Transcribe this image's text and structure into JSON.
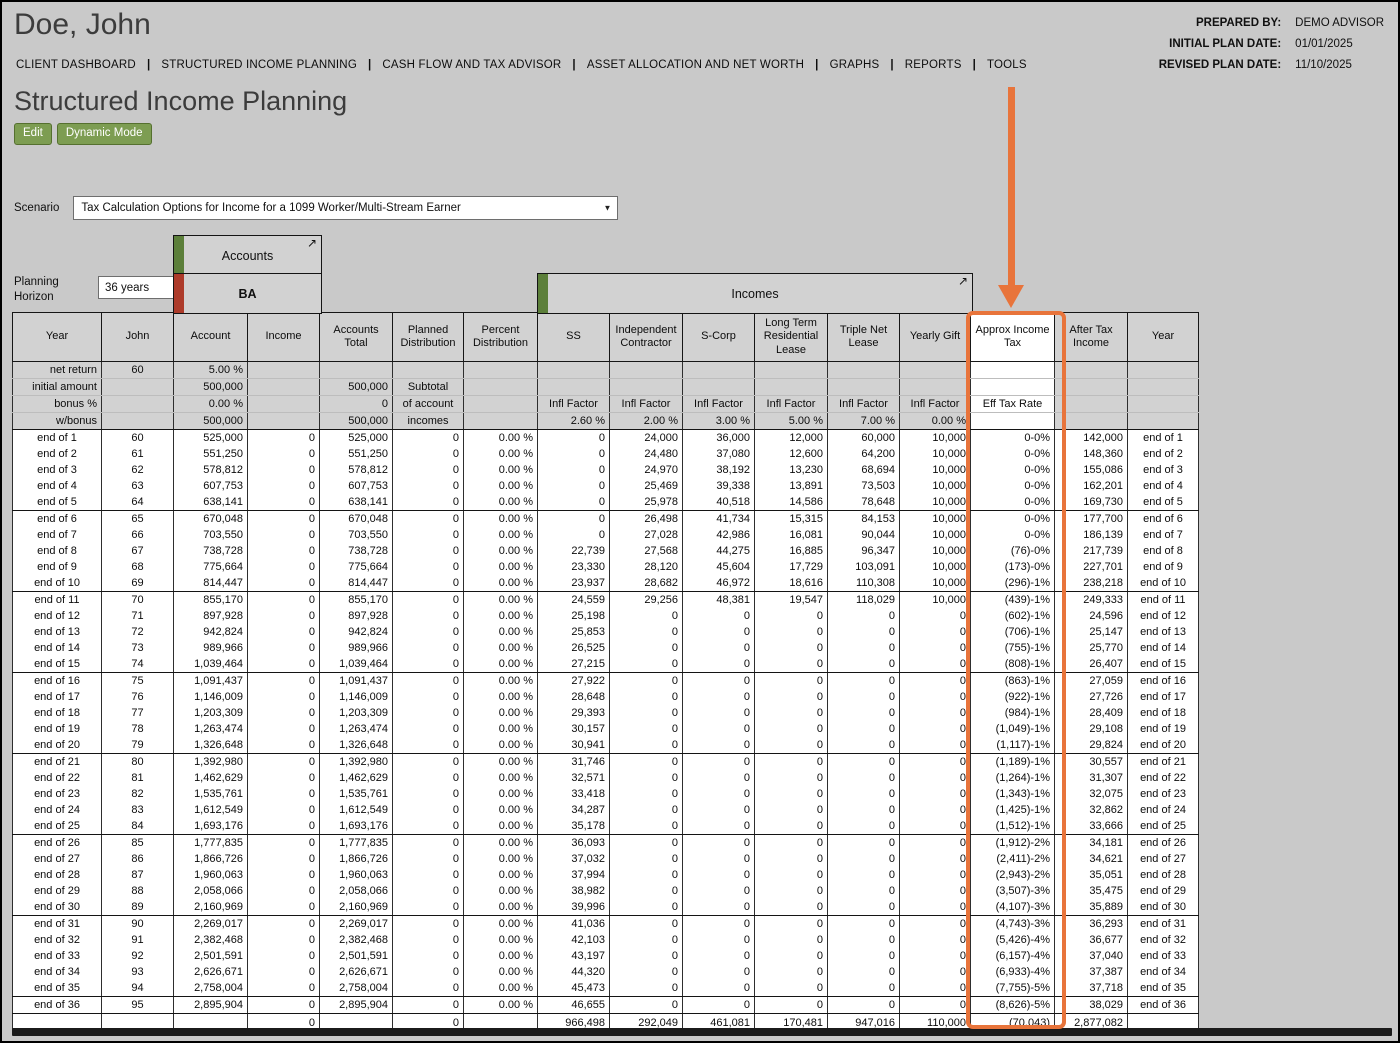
{
  "header": {
    "client_name": "Doe, John",
    "prepared_by_label": "PREPARED BY:",
    "prepared_by_value": "DEMO ADVISOR",
    "initial_plan_date_label": "INITIAL PLAN DATE:",
    "initial_plan_date_value": "01/01/2025",
    "revised_plan_date_label": "REVISED PLAN DATE:",
    "revised_plan_date_value": "11/10/2025"
  },
  "nav": {
    "separator": "|",
    "items": [
      "CLIENT DASHBOARD",
      "STRUCTURED INCOME PLANNING",
      "CASH FLOW AND TAX ADVISOR",
      "ASSET ALLOCATION AND NET WORTH",
      "GRAPHS",
      "REPORTS",
      "TOOLS"
    ]
  },
  "page": {
    "title": "Structured Income Planning"
  },
  "toolbar": {
    "edit_label": "Edit",
    "dynamic_mode_label": "Dynamic Mode"
  },
  "scenario": {
    "label": "Scenario",
    "value": "Tax Calculation Options for Income for a 1099 Worker/Multi-Stream Earner"
  },
  "planning_horizon": {
    "label_line1": "Planning",
    "label_line2": "Horizon",
    "value": "36 years"
  },
  "groups": {
    "accounts": "Accounts",
    "ba": "BA",
    "incomes": "Incomes",
    "expand_icon_glyph": "↗",
    "chevron_glyph": "▼"
  },
  "table": {
    "columns": [
      "Year",
      "John",
      "Account",
      "Income",
      "Accounts Total",
      "Planned Distribution",
      "Percent Distribution",
      "SS",
      "Independent Contractor",
      "S-Corp",
      "Long Term Residential Lease",
      "Triple Net Lease",
      "Yearly Gift",
      "Approx Income Tax",
      "After Tax Income",
      "Year"
    ],
    "setup_rows": [
      {
        "name": "net-return",
        "cells": [
          "net return",
          "60",
          "5.00 %",
          "",
          "",
          "",
          "",
          "",
          "",
          "",
          "",
          "",
          "",
          "",
          "",
          ""
        ],
        "orange": [
          2
        ],
        "center": [
          1
        ]
      },
      {
        "name": "initial-amount",
        "cells": [
          "initial amount",
          "",
          "500,000",
          "",
          "500,000",
          "Subtotal",
          "",
          "",
          "",
          "",
          "",
          "",
          "",
          "",
          "",
          ""
        ],
        "orange": [],
        "center": [
          5
        ]
      },
      {
        "name": "bonus-pct",
        "cells": [
          "bonus %",
          "",
          "0.00 %",
          "",
          "0",
          "of account",
          "",
          "Infl Factor",
          "Infl Factor",
          "Infl Factor",
          "Infl Factor",
          "Infl Factor",
          "Infl Factor",
          "Eff Tax Rate",
          "",
          ""
        ],
        "orange": [],
        "center": [
          5,
          7,
          8,
          9,
          10,
          11,
          12,
          13
        ]
      },
      {
        "name": "w-bonus",
        "cells": [
          "w/bonus",
          "",
          "500,000",
          "",
          "500,000",
          "incomes",
          "",
          "2.60 %",
          "2.00 %",
          "3.00 %",
          "5.00 %",
          "7.00 %",
          "0.00 %",
          "",
          "",
          ""
        ],
        "orange": [
          7,
          8,
          9,
          10,
          11,
          12
        ],
        "center": [
          5
        ]
      }
    ],
    "rows": [
      [
        "end of 1",
        "60",
        "525,000",
        "0",
        "525,000",
        "0",
        "0.00 %",
        "0",
        "24,000",
        "36,000",
        "12,000",
        "60,000",
        "10,000",
        "0-0%",
        "142,000"
      ],
      [
        "end of 2",
        "61",
        "551,250",
        "0",
        "551,250",
        "0",
        "0.00 %",
        "0",
        "24,480",
        "37,080",
        "12,600",
        "64,200",
        "10,000",
        "0-0%",
        "148,360"
      ],
      [
        "end of 3",
        "62",
        "578,812",
        "0",
        "578,812",
        "0",
        "0.00 %",
        "0",
        "24,970",
        "38,192",
        "13,230",
        "68,694",
        "10,000",
        "0-0%",
        "155,086"
      ],
      [
        "end of 4",
        "63",
        "607,753",
        "0",
        "607,753",
        "0",
        "0.00 %",
        "0",
        "25,469",
        "39,338",
        "13,891",
        "73,503",
        "10,000",
        "0-0%",
        "162,201"
      ],
      [
        "end of 5",
        "64",
        "638,141",
        "0",
        "638,141",
        "0",
        "0.00 %",
        "0",
        "25,978",
        "40,518",
        "14,586",
        "78,648",
        "10,000",
        "0-0%",
        "169,730"
      ],
      [
        "end of 6",
        "65",
        "670,048",
        "0",
        "670,048",
        "0",
        "0.00 %",
        "0",
        "26,498",
        "41,734",
        "15,315",
        "84,153",
        "10,000",
        "0-0%",
        "177,700"
      ],
      [
        "end of 7",
        "66",
        "703,550",
        "0",
        "703,550",
        "0",
        "0.00 %",
        "0",
        "27,028",
        "42,986",
        "16,081",
        "90,044",
        "10,000",
        "0-0%",
        "186,139"
      ],
      [
        "end of 8",
        "67",
        "738,728",
        "0",
        "738,728",
        "0",
        "0.00 %",
        "22,739",
        "27,568",
        "44,275",
        "16,885",
        "96,347",
        "10,000",
        "(76)-0%",
        "217,739"
      ],
      [
        "end of 9",
        "68",
        "775,664",
        "0",
        "775,664",
        "0",
        "0.00 %",
        "23,330",
        "28,120",
        "45,604",
        "17,729",
        "103,091",
        "10,000",
        "(173)-0%",
        "227,701"
      ],
      [
        "end of 10",
        "69",
        "814,447",
        "0",
        "814,447",
        "0",
        "0.00 %",
        "23,937",
        "28,682",
        "46,972",
        "18,616",
        "110,308",
        "10,000",
        "(296)-1%",
        "238,218"
      ],
      [
        "end of 11",
        "70",
        "855,170",
        "0",
        "855,170",
        "0",
        "0.00 %",
        "24,559",
        "29,256",
        "48,381",
        "19,547",
        "118,029",
        "10,000",
        "(439)-1%",
        "249,333"
      ],
      [
        "end of 12",
        "71",
        "897,928",
        "0",
        "897,928",
        "0",
        "0.00 %",
        "25,198",
        "0",
        "0",
        "0",
        "0",
        "0",
        "(602)-1%",
        "24,596"
      ],
      [
        "end of 13",
        "72",
        "942,824",
        "0",
        "942,824",
        "0",
        "0.00 %",
        "25,853",
        "0",
        "0",
        "0",
        "0",
        "0",
        "(706)-1%",
        "25,147"
      ],
      [
        "end of 14",
        "73",
        "989,966",
        "0",
        "989,966",
        "0",
        "0.00 %",
        "26,525",
        "0",
        "0",
        "0",
        "0",
        "0",
        "(755)-1%",
        "25,770"
      ],
      [
        "end of 15",
        "74",
        "1,039,464",
        "0",
        "1,039,464",
        "0",
        "0.00 %",
        "27,215",
        "0",
        "0",
        "0",
        "0",
        "0",
        "(808)-1%",
        "26,407"
      ],
      [
        "end of 16",
        "75",
        "1,091,437",
        "0",
        "1,091,437",
        "0",
        "0.00 %",
        "27,922",
        "0",
        "0",
        "0",
        "0",
        "0",
        "(863)-1%",
        "27,059"
      ],
      [
        "end of 17",
        "76",
        "1,146,009",
        "0",
        "1,146,009",
        "0",
        "0.00 %",
        "28,648",
        "0",
        "0",
        "0",
        "0",
        "0",
        "(922)-1%",
        "27,726"
      ],
      [
        "end of 18",
        "77",
        "1,203,309",
        "0",
        "1,203,309",
        "0",
        "0.00 %",
        "29,393",
        "0",
        "0",
        "0",
        "0",
        "0",
        "(984)-1%",
        "28,409"
      ],
      [
        "end of 19",
        "78",
        "1,263,474",
        "0",
        "1,263,474",
        "0",
        "0.00 %",
        "30,157",
        "0",
        "0",
        "0",
        "0",
        "0",
        "(1,049)-1%",
        "29,108"
      ],
      [
        "end of 20",
        "79",
        "1,326,648",
        "0",
        "1,326,648",
        "0",
        "0.00 %",
        "30,941",
        "0",
        "0",
        "0",
        "0",
        "0",
        "(1,117)-1%",
        "29,824"
      ],
      [
        "end of 21",
        "80",
        "1,392,980",
        "0",
        "1,392,980",
        "0",
        "0.00 %",
        "31,746",
        "0",
        "0",
        "0",
        "0",
        "0",
        "(1,189)-1%",
        "30,557"
      ],
      [
        "end of 22",
        "81",
        "1,462,629",
        "0",
        "1,462,629",
        "0",
        "0.00 %",
        "32,571",
        "0",
        "0",
        "0",
        "0",
        "0",
        "(1,264)-1%",
        "31,307"
      ],
      [
        "end of 23",
        "82",
        "1,535,761",
        "0",
        "1,535,761",
        "0",
        "0.00 %",
        "33,418",
        "0",
        "0",
        "0",
        "0",
        "0",
        "(1,343)-1%",
        "32,075"
      ],
      [
        "end of 24",
        "83",
        "1,612,549",
        "0",
        "1,612,549",
        "0",
        "0.00 %",
        "34,287",
        "0",
        "0",
        "0",
        "0",
        "0",
        "(1,425)-1%",
        "32,862"
      ],
      [
        "end of 25",
        "84",
        "1,693,176",
        "0",
        "1,693,176",
        "0",
        "0.00 %",
        "35,178",
        "0",
        "0",
        "0",
        "0",
        "0",
        "(1,512)-1%",
        "33,666"
      ],
      [
        "end of 26",
        "85",
        "1,777,835",
        "0",
        "1,777,835",
        "0",
        "0.00 %",
        "36,093",
        "0",
        "0",
        "0",
        "0",
        "0",
        "(1,912)-2%",
        "34,181"
      ],
      [
        "end of 27",
        "86",
        "1,866,726",
        "0",
        "1,866,726",
        "0",
        "0.00 %",
        "37,032",
        "0",
        "0",
        "0",
        "0",
        "0",
        "(2,411)-2%",
        "34,621"
      ],
      [
        "end of 28",
        "87",
        "1,960,063",
        "0",
        "1,960,063",
        "0",
        "0.00 %",
        "37,994",
        "0",
        "0",
        "0",
        "0",
        "0",
        "(2,943)-2%",
        "35,051"
      ],
      [
        "end of 29",
        "88",
        "2,058,066",
        "0",
        "2,058,066",
        "0",
        "0.00 %",
        "38,982",
        "0",
        "0",
        "0",
        "0",
        "0",
        "(3,507)-3%",
        "35,475"
      ],
      [
        "end of 30",
        "89",
        "2,160,969",
        "0",
        "2,160,969",
        "0",
        "0.00 %",
        "39,996",
        "0",
        "0",
        "0",
        "0",
        "0",
        "(4,107)-3%",
        "35,889"
      ],
      [
        "end of 31",
        "90",
        "2,269,017",
        "0",
        "2,269,017",
        "0",
        "0.00 %",
        "41,036",
        "0",
        "0",
        "0",
        "0",
        "0",
        "(4,743)-3%",
        "36,293"
      ],
      [
        "end of 32",
        "91",
        "2,382,468",
        "0",
        "2,382,468",
        "0",
        "0.00 %",
        "42,103",
        "0",
        "0",
        "0",
        "0",
        "0",
        "(5,426)-4%",
        "36,677"
      ],
      [
        "end of 33",
        "92",
        "2,501,591",
        "0",
        "2,501,591",
        "0",
        "0.00 %",
        "43,197",
        "0",
        "0",
        "0",
        "0",
        "0",
        "(6,157)-4%",
        "37,040"
      ],
      [
        "end of 34",
        "93",
        "2,626,671",
        "0",
        "2,626,671",
        "0",
        "0.00 %",
        "44,320",
        "0",
        "0",
        "0",
        "0",
        "0",
        "(6,933)-4%",
        "37,387"
      ],
      [
        "end of 35",
        "94",
        "2,758,004",
        "0",
        "2,758,004",
        "0",
        "0.00 %",
        "45,473",
        "0",
        "0",
        "0",
        "0",
        "0",
        "(7,755)-5%",
        "37,718"
      ],
      [
        "end of 36",
        "95",
        "2,895,904",
        "0",
        "2,895,904",
        "0",
        "0.00 %",
        "46,655",
        "0",
        "0",
        "0",
        "0",
        "0",
        "(8,626)-5%",
        "38,029"
      ]
    ],
    "totals": [
      "",
      "",
      "",
      "0",
      "",
      "0",
      "",
      "966,498",
      "292,049",
      "461,081",
      "170,481",
      "947,016",
      "110,000",
      "(70,043)",
      "2,877,082",
      ""
    ]
  },
  "colors": {
    "highlight_orange": "#E8743B",
    "editable_cell_orange": "#DFA14B",
    "button_green": "#7D9D52",
    "accounts_strip_green": "#5C7F3A",
    "ba_strip_red": "#AD3B2A",
    "header_gray": "#D2D2D2",
    "page_gray": "#C9C9C9"
  }
}
